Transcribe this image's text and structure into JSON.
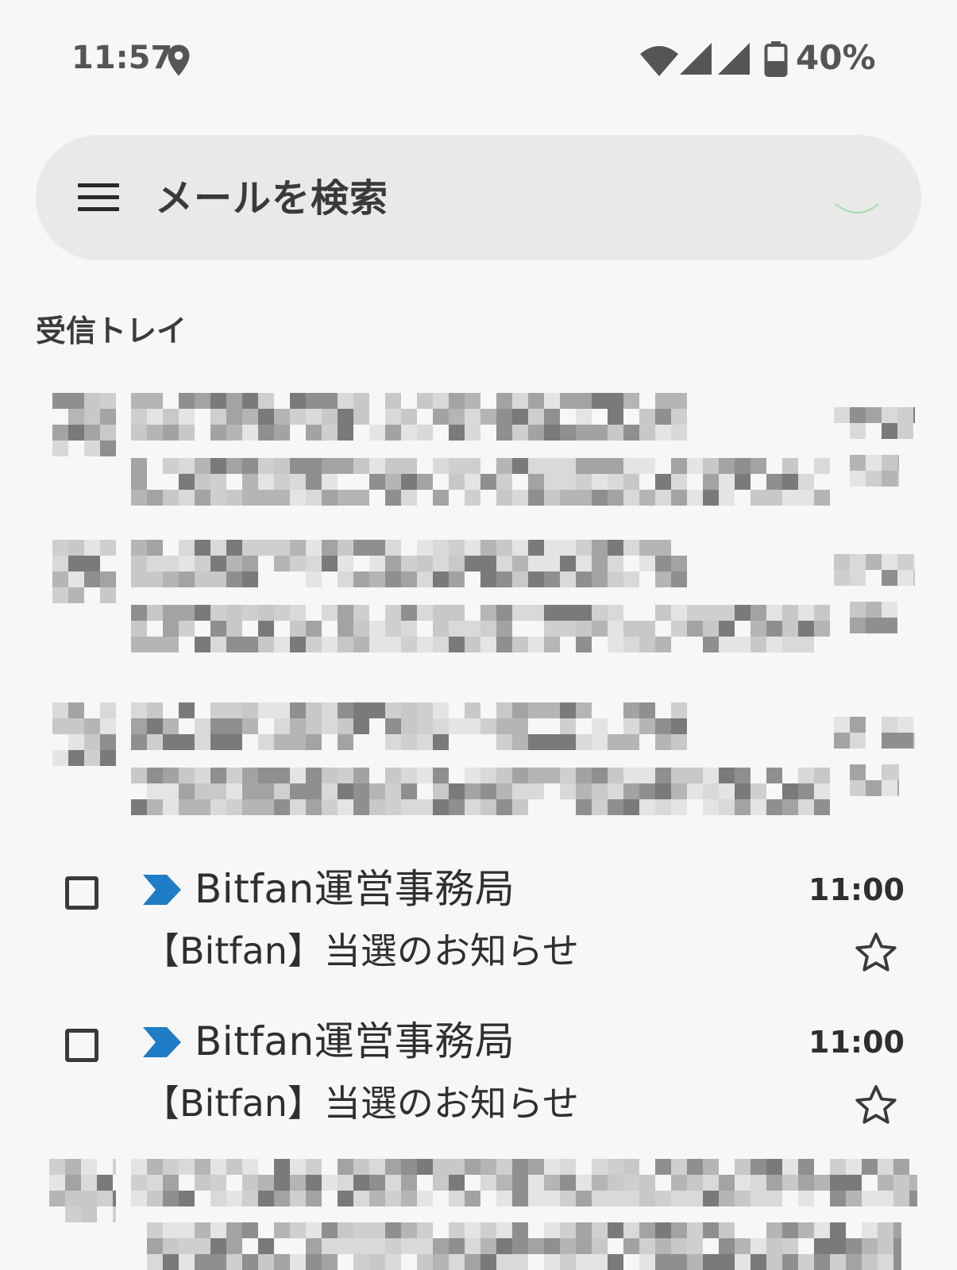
{
  "status_bar": {
    "time": "11:57",
    "battery_percent": "40%",
    "icons": [
      "location-icon",
      "wifi-icon",
      "signal-icon",
      "signal-icon",
      "battery-icon"
    ]
  },
  "search": {
    "placeholder": "メールを検索",
    "menu_icon": "menu-icon"
  },
  "section_title": "受信トレイ",
  "mails": [
    {
      "sender": "Bitfan運営事務局",
      "subject": "【Bitfan】当選のお知らせ",
      "time": "11:00",
      "important": true,
      "starred": false,
      "checked": false
    },
    {
      "sender": "Bitfan運営事務局",
      "subject": "【Bitfan】当選のお知らせ",
      "time": "11:00",
      "important": true,
      "starred": false,
      "checked": false
    }
  ],
  "colors": {
    "background": "#f7f7f7",
    "search_bar": "#e9e9e9",
    "importance": "#1f7cc6",
    "text": "#2f2f2f"
  }
}
